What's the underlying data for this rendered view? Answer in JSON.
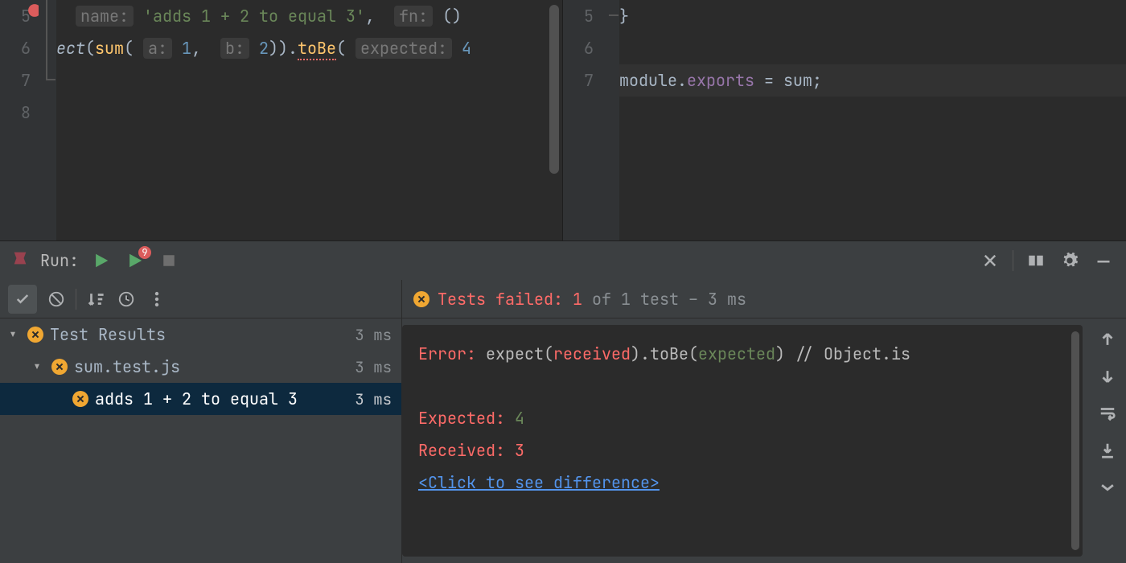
{
  "editor_left": {
    "lines": {
      "5": {
        "num": "5",
        "name_hint": "name:",
        "name_val": "'adds 1 + 2 to equal 3'",
        "fn_hint": "fn:",
        "fn_paren": "()"
      },
      "6": {
        "num": "6",
        "prefix": "ect",
        "call_open": "(",
        "fn1": "sum",
        "a_hint": "a:",
        "a_val": "1",
        "b_hint": "b:",
        "b_val": "2",
        "mid": ")).",
        "toBe": "toBe",
        "open2": "(",
        "exp_hint": "expected:",
        "exp_val": "4"
      },
      "7": {
        "num": "7"
      },
      "8": {
        "num": "8"
      }
    }
  },
  "editor_right": {
    "lines": {
      "5": {
        "num": "5",
        "brace": "}"
      },
      "6": {
        "num": "6"
      },
      "7": {
        "num": "7",
        "module": "module",
        "dot": ".",
        "exports": "exports",
        "eq": " = ",
        "sum": "sum",
        "semi": ";"
      }
    }
  },
  "run": {
    "label": "Run:",
    "rerun_fail_badge": "9"
  },
  "tests": {
    "status_prefix": "Tests failed:",
    "status_failed_count": "1",
    "status_rest": " of 1 test – 3 ms",
    "tree": {
      "root": {
        "label": "Test Results",
        "time": "3 ms"
      },
      "file": {
        "label": "sum.test.js",
        "time": "3 ms"
      },
      "case": {
        "label": "adds 1 + 2 to equal 3",
        "time": "3 ms"
      }
    }
  },
  "console": {
    "line1_err": "Error:",
    "line1_rest_a": " expect(",
    "line1_received": "received",
    "line1_rest_b": ").toBe(",
    "line1_expected": "expected",
    "line1_rest_c": ") // Object.is",
    "exp_label": "Expected: ",
    "exp_val": "4",
    "rec_label": "Received: ",
    "rec_val": "3",
    "diff_link": "<Click to see difference>"
  }
}
